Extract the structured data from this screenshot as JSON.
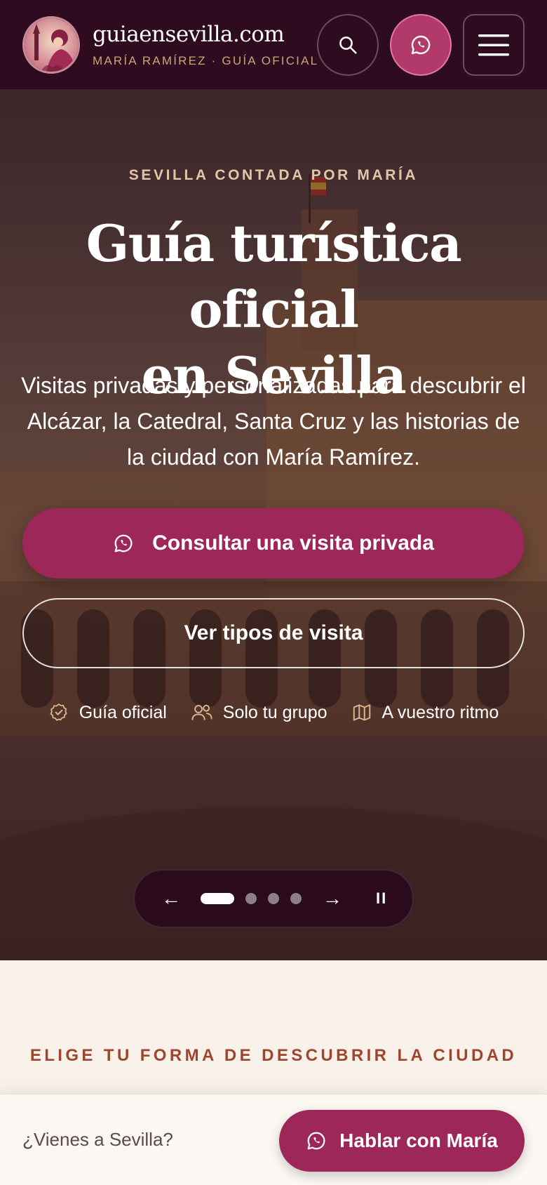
{
  "header": {
    "brand_name": "guiaensevilla.com",
    "brand_sub": "MARÍA RAMÍREZ · GUÍA OFICIAL",
    "search_icon": "search-icon",
    "whatsapp_icon": "whatsapp-icon",
    "menu_icon": "hamburger-menu-icon"
  },
  "hero": {
    "eyebrow": "SEVILLA CONTADA POR MARÍA",
    "title_line1": "Guía turística oficial",
    "title_line2": "en Sevilla",
    "lead": "Visitas privadas y personalizadas para descubrir el Alcázar, la Catedral, Santa Cruz y las historias de la ciudad con María Ramírez.",
    "cta_primary": "Consultar una visita privada",
    "cta_secondary": "Ver tipos de visita",
    "features": [
      {
        "icon": "badge-check-icon",
        "label": "Guía oficial"
      },
      {
        "icon": "users-icon",
        "label": "Solo tu grupo"
      },
      {
        "icon": "map-icon",
        "label": "A vuestro ritmo"
      }
    ],
    "slider": {
      "prev": "←",
      "next": "→",
      "pause": "II",
      "total": 4,
      "active": 1
    }
  },
  "section": {
    "eyebrow": "ELIGE TU FORMA DE DESCUBRIR LA CIUDAD"
  },
  "bottom_bar": {
    "question": "¿Vienes a Sevilla?",
    "cta": "Hablar con María"
  },
  "colors": {
    "header_bg": "#2e0b1e",
    "accent": "#9c2758",
    "gold": "#c9a57e",
    "section_eyebrow": "#a0442e"
  }
}
